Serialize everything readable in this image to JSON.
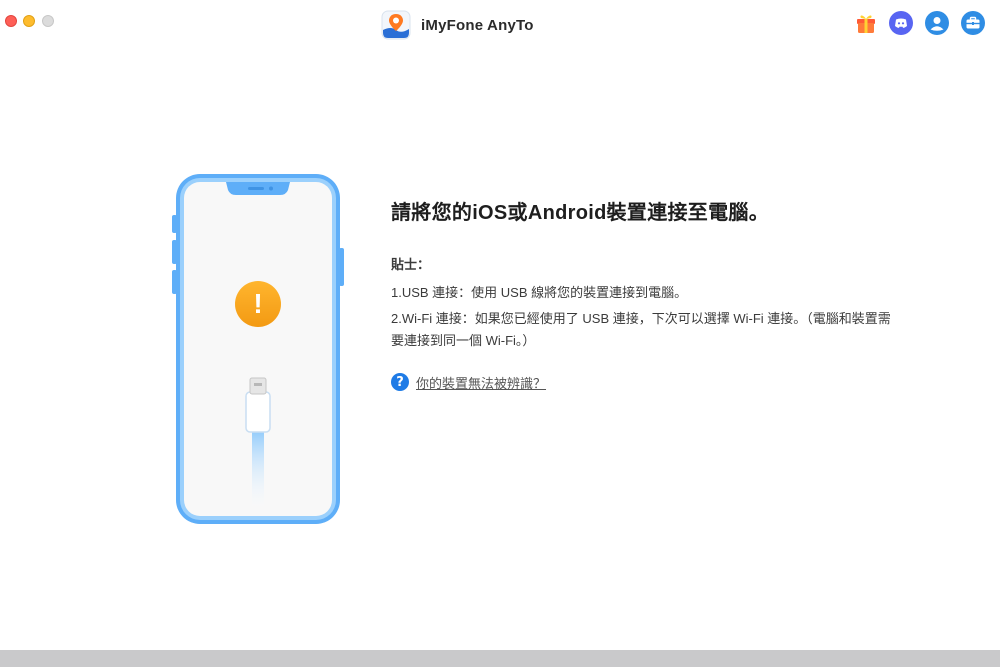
{
  "window": {
    "title": "iMyFone AnyTo"
  },
  "toolbar": {
    "icons": [
      "gift-icon",
      "discord-icon",
      "account-icon",
      "toolbox-icon"
    ]
  },
  "main": {
    "heading": "請將您的iOS或Android裝置連接至電腦。",
    "tips_title": "貼士：",
    "tip1": "1.USB 連接：使用 USB 線將您的裝置連接到電腦。",
    "tip2": "2.Wi-Fi 連接：如果您已經使用了 USB 連接，下次可以選擇 Wi-Fi 連接。（電腦和裝置需要連接到同一個 Wi-Fi。）",
    "help_link": "你的裝置無法被辨識？",
    "warning_symbol": "!"
  },
  "colors": {
    "accent": "#1f7be6",
    "phone_frame": "#5eaef8",
    "warning": "#f5a623"
  }
}
